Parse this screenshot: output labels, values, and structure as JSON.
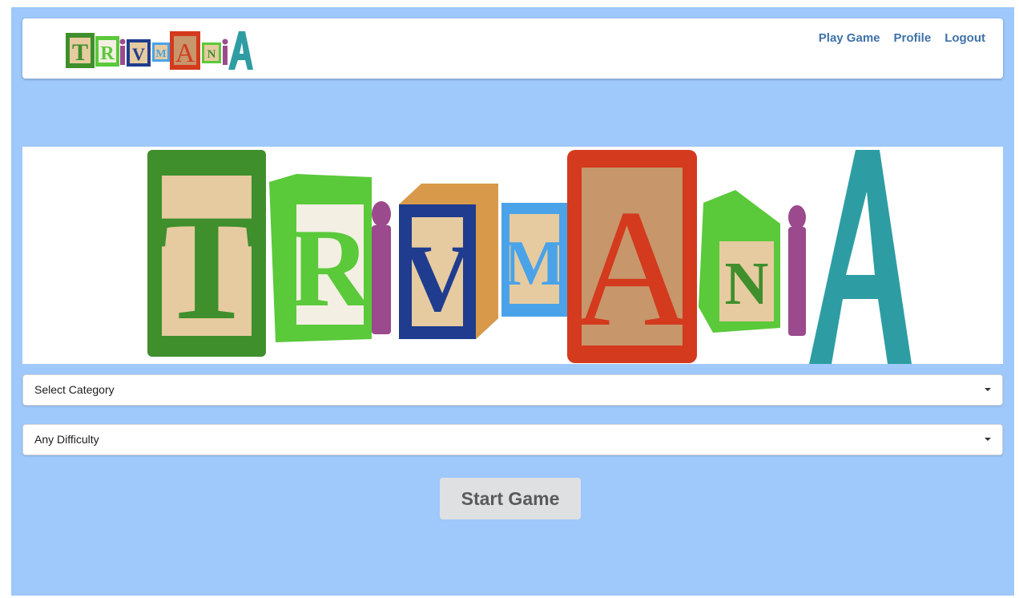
{
  "brand": {
    "logo_text": "TRiVMANiA"
  },
  "nav": {
    "items": [
      {
        "label": "Play Game"
      },
      {
        "label": "Profile"
      },
      {
        "label": "Logout"
      }
    ]
  },
  "banner": {
    "logo_text": "TRiVMANiA"
  },
  "form": {
    "category": {
      "value": "Select Category"
    },
    "difficulty": {
      "value": "Any Difficulty"
    }
  },
  "actions": {
    "start_label": "Start Game"
  },
  "colors": {
    "page_background": "#9fc8fb",
    "nav_link": "#3f71a8",
    "block_green": "#3f8f2c",
    "block_lime": "#5ac93a",
    "block_navy": "#1f3c8e",
    "block_sky": "#4aa3e8",
    "block_red": "#d33a1e",
    "block_teal": "#2e9da3",
    "block_purple": "#9b4a8e",
    "wood": "#e6cba0"
  }
}
